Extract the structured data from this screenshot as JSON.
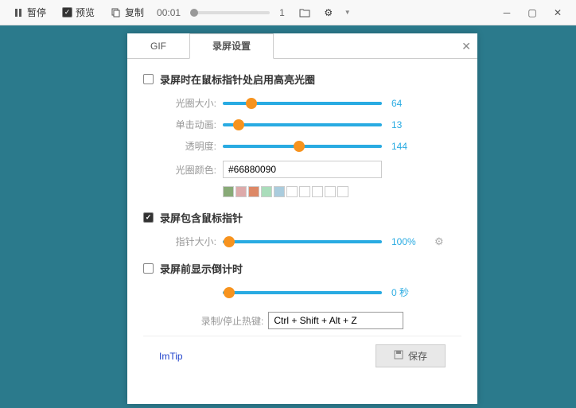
{
  "toolbar": {
    "pause": "暂停",
    "preview": "预览",
    "copy": "复制",
    "time": "00:01",
    "frame": "1"
  },
  "dialog": {
    "tabs": {
      "gif": "GIF",
      "settings": "录屏设置"
    },
    "section1": {
      "title": "录屏时在鼠标指针处启用高亮光圈",
      "size_label": "光圈大小:",
      "size_value": "64",
      "click_label": "单击动画:",
      "click_value": "13",
      "opacity_label": "透明度:",
      "opacity_value": "144",
      "color_label": "光圈颜色:",
      "color_value": "#66880090"
    },
    "swatch_colors": [
      "#88aa77",
      "#ddaaaa",
      "#dd8866",
      "#aaddbb",
      "#aaccdd",
      "#ffffff",
      "#ffffff",
      "#ffffff",
      "#ffffff",
      "#ffffff"
    ],
    "section2": {
      "title": "录屏包含鼠标指针",
      "size_label": "指针大小:",
      "size_value": "100%"
    },
    "section3": {
      "title": "录屏前显示倒计时",
      "value": "0 秒"
    },
    "hotkey": {
      "label": "录制/停止热键:",
      "value": "Ctrl + Shift + Alt + Z"
    },
    "link": "ImTip",
    "save": "保存"
  }
}
